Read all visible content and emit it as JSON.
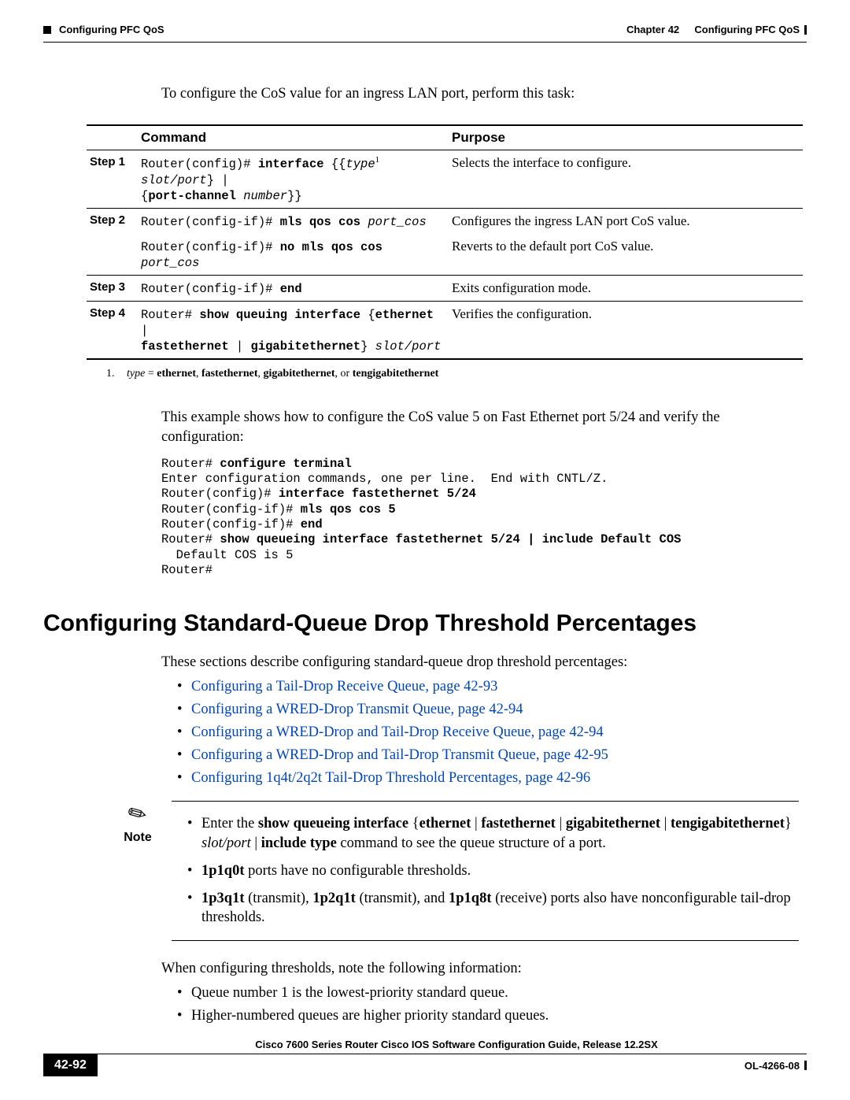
{
  "header": {
    "chapter": "Chapter 42",
    "chapter_title": "Configuring PFC QoS",
    "section": "Configuring PFC QoS"
  },
  "intro": "To configure the CoS value for an ingress LAN port, perform this task:",
  "table": {
    "head_command": "Command",
    "head_purpose": "Purpose",
    "step1": "Step 1",
    "step2": "Step 2",
    "step3": "Step 3",
    "step4": "Step 4",
    "r1_purpose": "Selects the interface to configure.",
    "r2a_purpose": "Configures the ingress LAN port CoS value.",
    "r2b_purpose": "Reverts to the default port CoS value.",
    "r3_purpose": "Exits configuration mode.",
    "r4_purpose": "Verifies the configuration."
  },
  "footnote_num": "1.",
  "example_intro": "This example shows how to configure the CoS value 5 on Fast Ethernet port 5/24 and verify the configuration:",
  "heading": "Configuring Standard-Queue Drop Threshold Percentages",
  "section_intro": "These sections describe configuring standard-queue drop threshold percentages:",
  "links": {
    "l1": "Configuring a Tail-Drop Receive Queue, page 42-93",
    "l2": "Configuring a WRED-Drop Transmit Queue, page 42-94",
    "l3": "Configuring a WRED-Drop and Tail-Drop Receive Queue, page 42-94",
    "l4": "Configuring a WRED-Drop and Tail-Drop Transmit Queue, page 42-95",
    "l5": "Configuring 1q4t/2q2t Tail-Drop Threshold Percentages, page 42-96"
  },
  "note_label": "Note",
  "when_text": "When configuring thresholds, note the following information:",
  "plain": {
    "p1": "Queue number 1 is the lowest-priority standard queue.",
    "p2": "Higher-numbered queues are higher priority standard queues."
  },
  "footer": {
    "guide": "Cisco 7600 Series Router Cisco IOS Software Configuration Guide, Release 12.2SX",
    "page": "42-92",
    "docid": "OL-4266-08"
  }
}
